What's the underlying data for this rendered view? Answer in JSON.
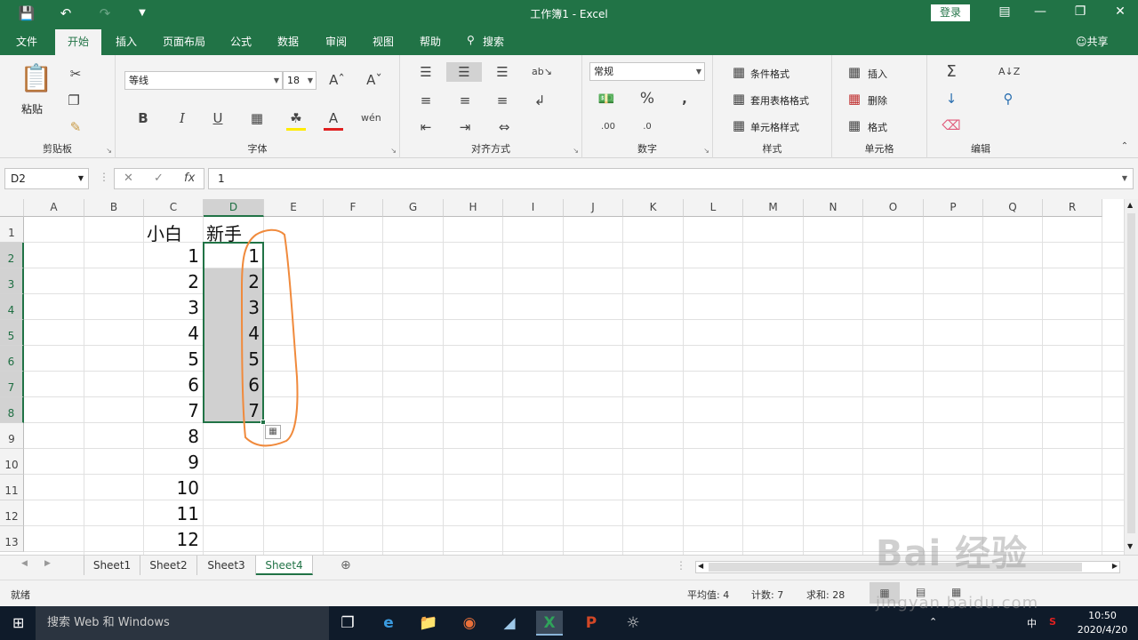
{
  "title": "工作簿1  -  Excel",
  "login_label": "登录",
  "share_label": "共享",
  "tabs": [
    {
      "label": "文件"
    },
    {
      "label": "开始"
    },
    {
      "label": "插入"
    },
    {
      "label": "页面布局"
    },
    {
      "label": "公式"
    },
    {
      "label": "数据"
    },
    {
      "label": "审阅"
    },
    {
      "label": "视图"
    },
    {
      "label": "帮助"
    },
    {
      "label": "搜索"
    }
  ],
  "ribbon": {
    "clipboard": {
      "paste": "粘贴",
      "group": "剪贴板"
    },
    "font": {
      "name": "等线",
      "size": "18",
      "group": "字体"
    },
    "alignment": {
      "group": "对齐方式"
    },
    "number": {
      "format": "常规",
      "group": "数字"
    },
    "styles": {
      "cond": "条件格式",
      "table": "套用表格格式",
      "cell": "单元格样式",
      "group": "样式"
    },
    "cells": {
      "insert": "插入",
      "delete": "删除",
      "format": "格式",
      "group": "单元格"
    },
    "editing": {
      "group": "编辑"
    }
  },
  "formula_bar": {
    "name_box": "D2",
    "formula": "1"
  },
  "columns": [
    "A",
    "B",
    "C",
    "D",
    "E",
    "F",
    "G",
    "H",
    "I",
    "J",
    "K",
    "L",
    "M",
    "N",
    "O",
    "P",
    "Q",
    "R"
  ],
  "rows": [
    "1",
    "2",
    "3",
    "4",
    "5",
    "6",
    "7",
    "8",
    "9",
    "10",
    "11",
    "12",
    "13"
  ],
  "cells": {
    "C1": "小白",
    "D1": "新手",
    "C": [
      "1",
      "2",
      "3",
      "4",
      "5",
      "6",
      "7",
      "8",
      "9",
      "10",
      "11",
      "12"
    ],
    "D": [
      "1",
      "2",
      "3",
      "4",
      "5",
      "6",
      "7"
    ]
  },
  "sheets": [
    "Sheet1",
    "Sheet2",
    "Sheet3",
    "Sheet4"
  ],
  "active_sheet": "Sheet4",
  "status": {
    "ready": "就绪",
    "average": "平均值: 4",
    "count": "计数: 7",
    "sum": "求和: 28"
  },
  "taskbar": {
    "search_placeholder": "搜索 Web 和 Windows",
    "ime": "中",
    "time": "10:50",
    "date": "2020/4/20"
  },
  "watermark": {
    "main": "Bai 经验",
    "url": "jingyan.baidu.com"
  },
  "colors": {
    "excel_green": "#217346",
    "annotation": "#f08a3c"
  }
}
